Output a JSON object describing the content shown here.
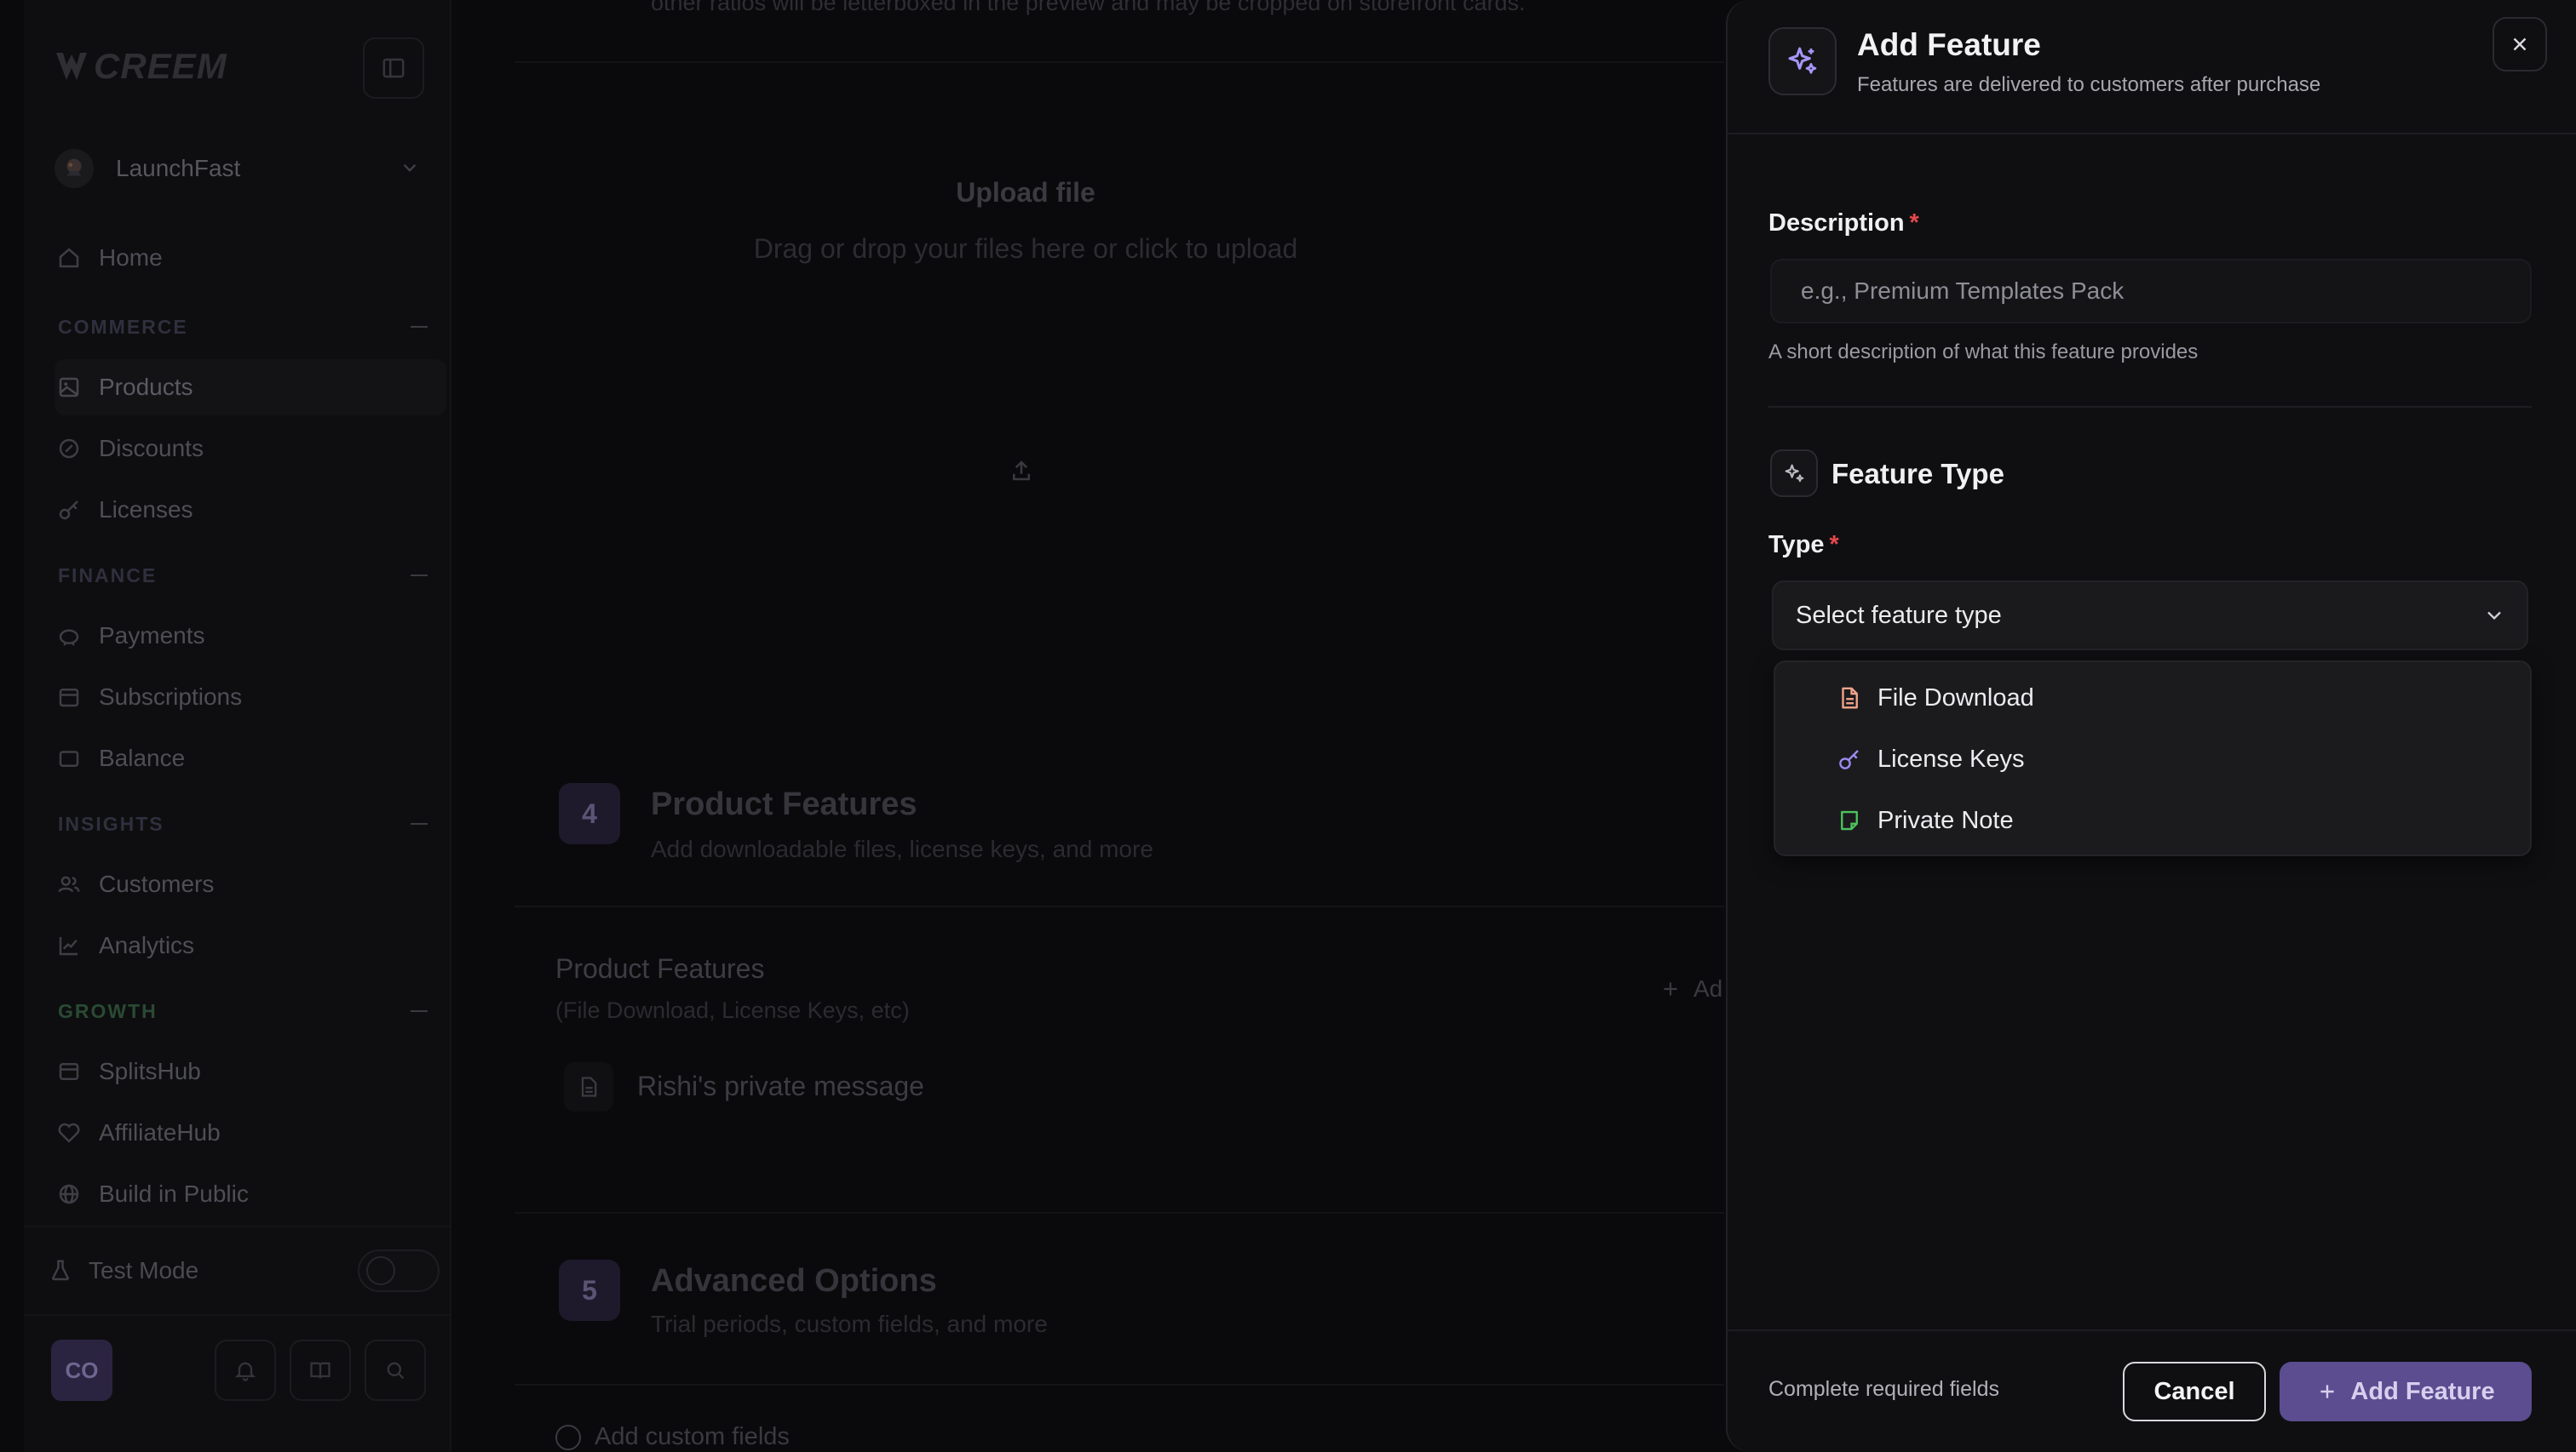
{
  "sidebar": {
    "brand": "CREEM",
    "workspace": {
      "name": "LaunchFast"
    },
    "sections": {
      "commerce": "COMMERCE",
      "finance": "FINANCE",
      "insights": "INSIGHTS",
      "growth": "GROWTH"
    },
    "items": {
      "home": "Home",
      "products": "Products",
      "discounts": "Discounts",
      "licenses": "Licenses",
      "payments": "Payments",
      "subscriptions": "Subscriptions",
      "balance": "Balance",
      "customers": "Customers",
      "analytics": "Analytics",
      "splitshub": "SplitsHub",
      "affiliatehub": "AffiliateHub",
      "build_in_public": "Build in Public"
    },
    "test_mode": "Test Mode",
    "user_initials": "CO"
  },
  "main": {
    "top_note": "other ratios will be letterboxed in the preview and may be cropped on storefront cards.",
    "upload": {
      "title": "Upload file",
      "subtitle": "Drag or drop your files here or click to upload"
    },
    "step4": {
      "number": "4",
      "title": "Product Features",
      "subtitle": "Add downloadable files, license keys, and more"
    },
    "product_features": {
      "title": "Product Features",
      "subtitle": "(File Download, License Keys, etc)",
      "add_label": "Ad",
      "row_text": "Rishi's private message"
    },
    "step5": {
      "number": "5",
      "title": "Advanced Options",
      "subtitle": "Trial periods, custom fields, and more"
    },
    "custom_fields": "Add custom fields"
  },
  "modal": {
    "title": "Add Feature",
    "subtitle": "Features are delivered to customers after purchase",
    "description_label": "Description",
    "required_mark": "*",
    "description_placeholder": "e.g., Premium Templates Pack",
    "description_help": "A short description of what this feature provides",
    "feature_type_heading": "Feature Type",
    "type_label": "Type",
    "select_placeholder": "Select feature type",
    "options": [
      {
        "label": "File Download",
        "icon": "file-text-icon",
        "color": "#f2a48a"
      },
      {
        "label": "License Keys",
        "icon": "key-icon",
        "color": "#9b8cf0"
      },
      {
        "label": "Private Note",
        "icon": "note-icon",
        "color": "#4cc35c"
      }
    ],
    "footer_note": "Complete required fields",
    "cancel_label": "Cancel",
    "add_label": "Add Feature"
  },
  "colors": {
    "accent": "#5b4d90",
    "required": "#e5484d",
    "sparkle": "#a796f7",
    "growth_section": "#2a4a33"
  }
}
